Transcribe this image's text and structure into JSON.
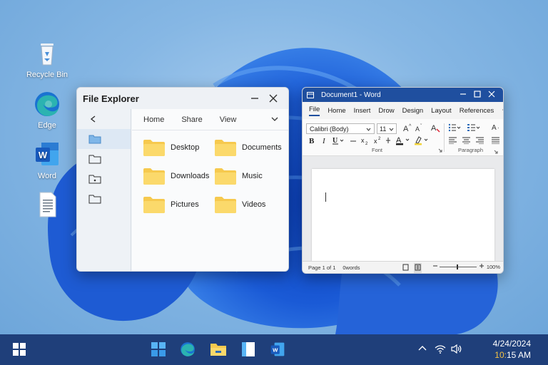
{
  "desktop": {
    "icons": [
      {
        "label": "Recycle Bin",
        "icon": "recycle-bin-icon"
      },
      {
        "label": "Edge",
        "icon": "edge-icon"
      },
      {
        "label": "Word",
        "icon": "word-icon"
      },
      {
        "label": "",
        "icon": "document-icon"
      }
    ]
  },
  "file_explorer": {
    "title": "File Explorer",
    "tabs": [
      "Home",
      "Share",
      "View"
    ],
    "folders": [
      "Desktop",
      "Documents",
      "Downloads",
      "Music",
      "Pictures",
      "Videos"
    ]
  },
  "word": {
    "title": "Document1 - Word",
    "menu": [
      "File",
      "Home",
      "Insert",
      "Drow",
      "Design",
      "Layout",
      "References"
    ],
    "font": "Calibri (Body)",
    "font_size": "11",
    "group_font": "Font",
    "group_paragraph": "Paragraph",
    "status_page": "Page 1 of 1",
    "status_words": "0words",
    "zoom": "100%"
  },
  "taskbar": {
    "date": "4/24/2024",
    "time_hour": "10:",
    "time_rest": "15 AM"
  },
  "colors": {
    "taskbar": "#1f3f7a",
    "word_blue": "#1f4f9f",
    "folder_yellow": "#f6c94e",
    "edge_teal": "#2bb3b1"
  }
}
